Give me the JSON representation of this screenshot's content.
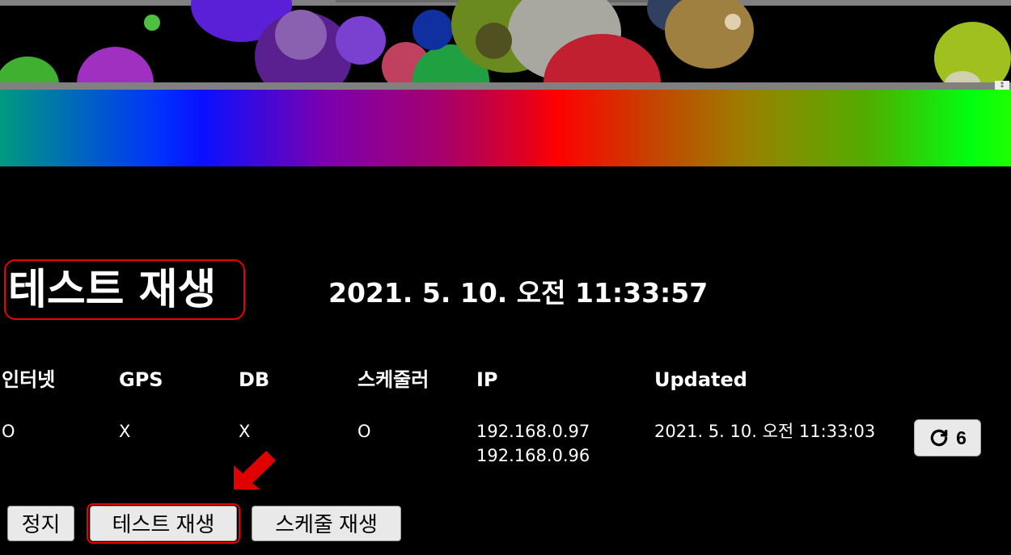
{
  "header": {
    "title": "테스트 재생",
    "datetime": "2021. 5. 10. 오전 11:33:57"
  },
  "status_table": {
    "columns": [
      "인터넷",
      "GPS",
      "DB",
      "스케줄러",
      "IP",
      "Updated"
    ],
    "row": {
      "internet": "O",
      "gps": "X",
      "db": "X",
      "scheduler": "O",
      "ip_lines": [
        "192.168.0.97",
        "192.168.0.96"
      ],
      "updated": "2021. 5. 10. 오전 11:33:03"
    },
    "refresh": {
      "icon": "refresh-icon",
      "count": "6"
    }
  },
  "buttons": {
    "stop": "정지",
    "test_play": "테스트 재생",
    "schedule_play": "스케줄 재생"
  },
  "annotations": {
    "highlight_color": "#e00000",
    "arrow_icon": "red-arrow-icon"
  }
}
